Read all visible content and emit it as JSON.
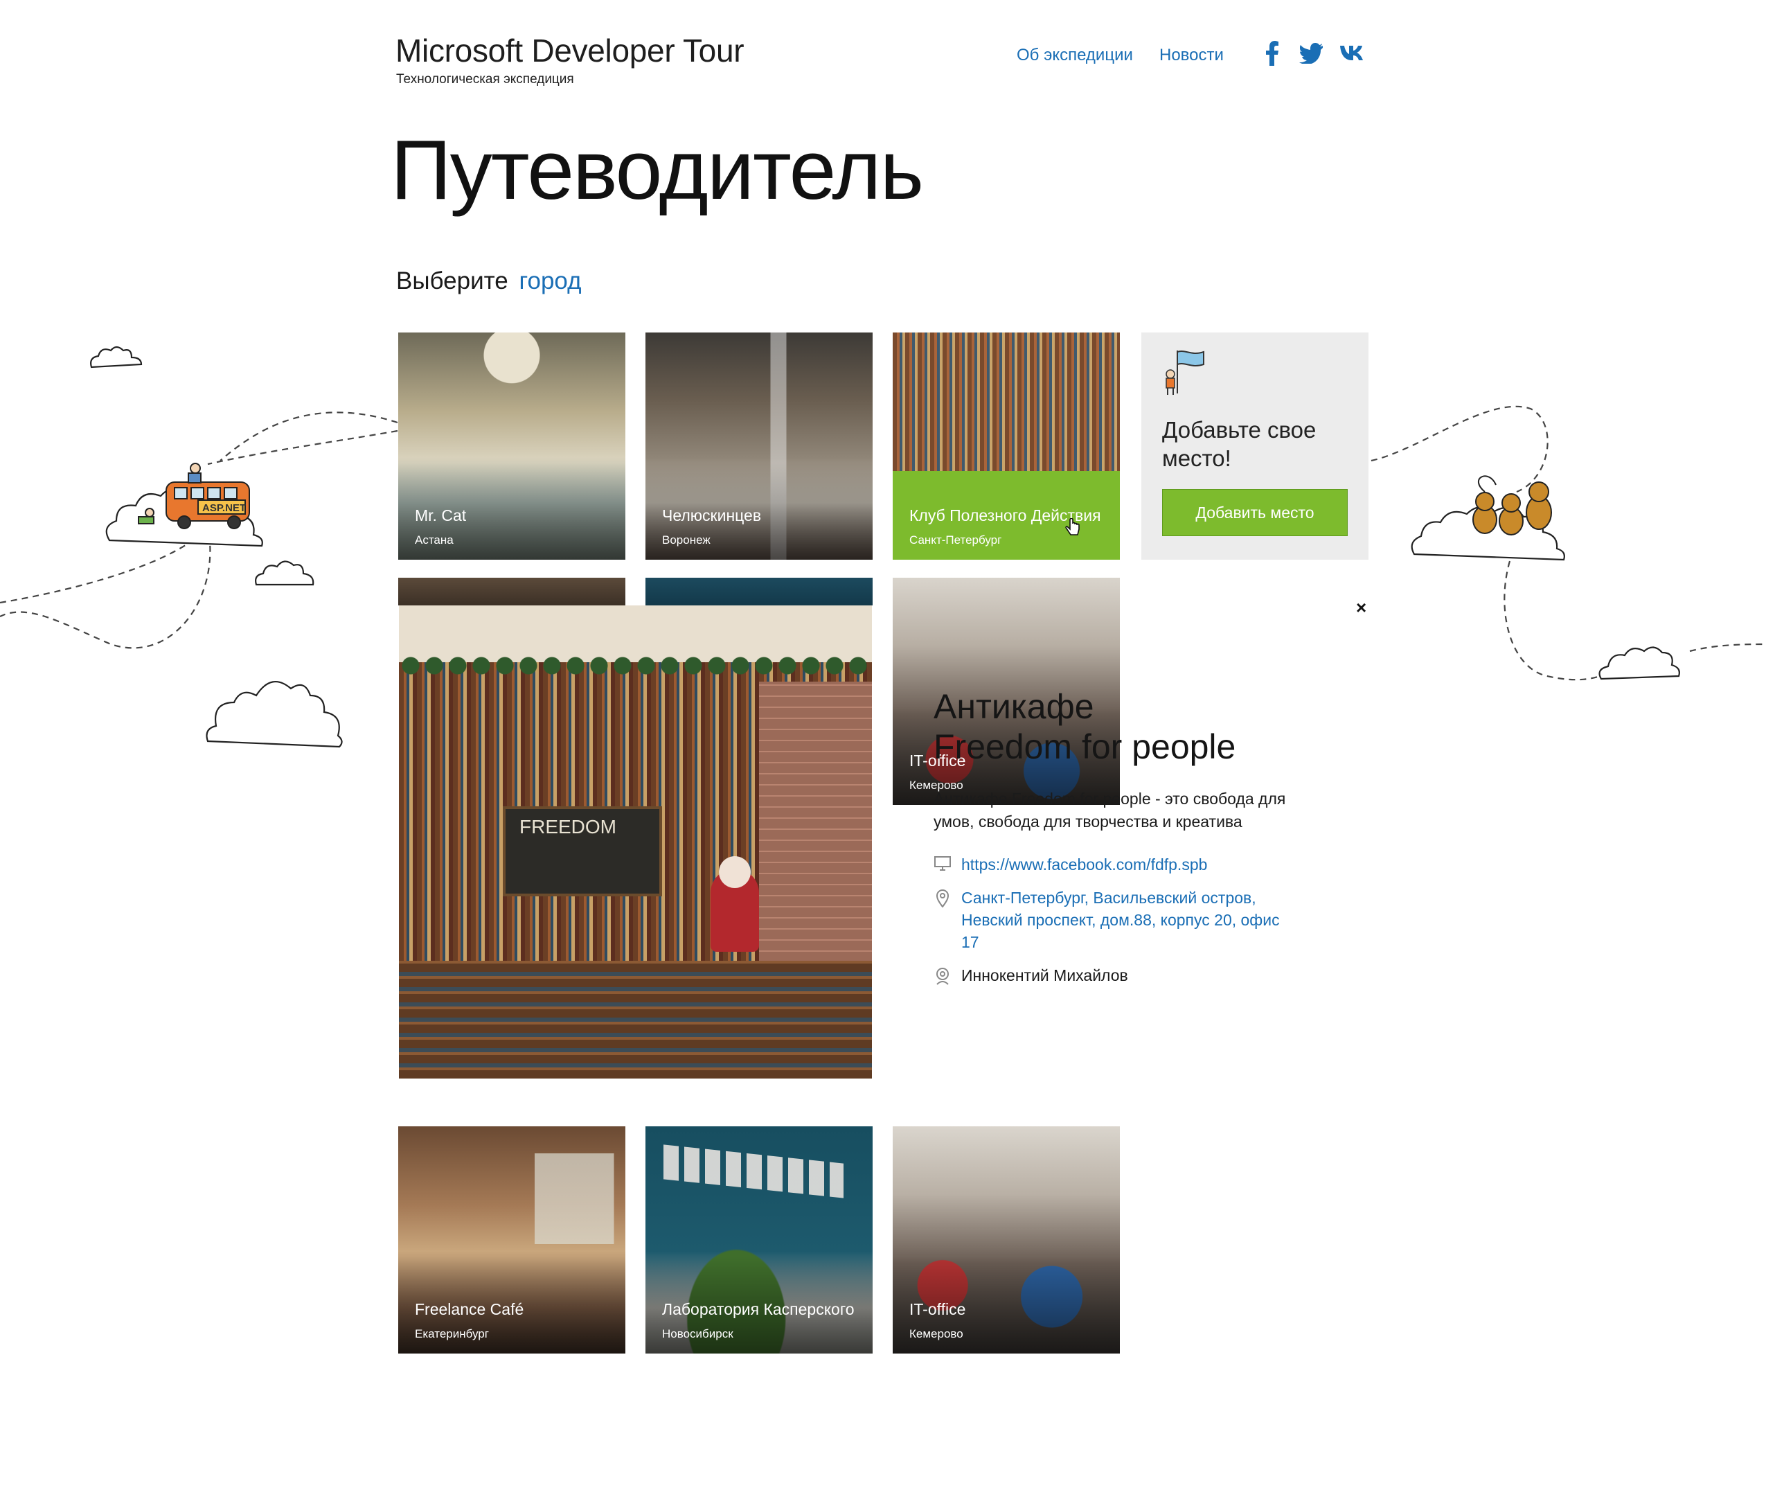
{
  "header": {
    "title": "Microsoft Developer Tour",
    "subtitle": "Технологическая экспедиция",
    "nav": [
      {
        "label": "Об экспедиции"
      },
      {
        "label": "Новости"
      }
    ],
    "social_icons": [
      "facebook-icon",
      "twitter-icon",
      "vk-icon"
    ]
  },
  "page": {
    "title": "Путеводитель",
    "choose_prefix": "Выберите",
    "choose_link": "город"
  },
  "tiles": [
    {
      "name": "Mr. Cat",
      "city": "Астана"
    },
    {
      "name": "Челюскинцев",
      "city": "Воронеж"
    },
    {
      "name": "Клуб Полезного Действия",
      "city": "Санкт-Петербург"
    },
    {
      "name": "IT-office",
      "city": "Кемерово"
    },
    {
      "name": "Freelance Café",
      "city": "Екатеринбург"
    },
    {
      "name": "Лаборатория Касперского",
      "city": "Новосибирск"
    },
    {
      "name": "IT-office",
      "city": "Кемерово"
    }
  ],
  "add_place": {
    "title": "Добавьте свое место!",
    "button": "Добавить место"
  },
  "detail": {
    "title_line1": "Антикафе",
    "title_line2": "Freedom for people",
    "description": "Антикафе Freedom for people - это свобода для умов, свобода для творчества и креатива",
    "website": "https://www.facebook.com/fdfp.spb",
    "address": "Санкт-Петербург, Васильевский остров, Невский проспект, дом.88, корпус 20, офис 17",
    "contact": "Иннокентий Михайлов",
    "close": "×",
    "photo_sign_text": "FREEDOM"
  },
  "decor": {
    "bus_sign": "ASP.NET"
  },
  "colors": {
    "accent_link": "#1a6eb5",
    "green": "#7dbb2d",
    "add_tile_bg": "#ececec"
  }
}
